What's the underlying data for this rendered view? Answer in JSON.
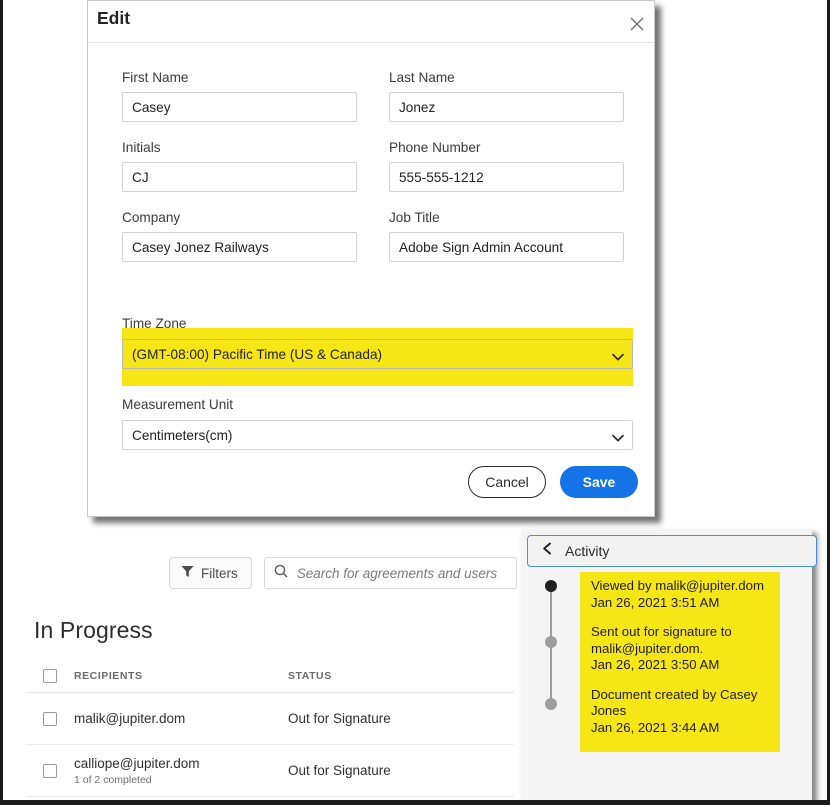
{
  "modal": {
    "title": "Edit",
    "close_icon": "close-icon",
    "fields": {
      "first_name": {
        "label": "First Name",
        "value": "Casey"
      },
      "last_name": {
        "label": "Last Name",
        "value": "Jonez"
      },
      "initials": {
        "label": "Initials",
        "value": "CJ"
      },
      "phone_number": {
        "label": "Phone Number",
        "value": "555-555-1212"
      },
      "company": {
        "label": "Company",
        "value": "Casey Jonez Railways"
      },
      "job_title": {
        "label": "Job Title",
        "value": "Adobe Sign Admin Account"
      },
      "time_zone": {
        "label": "Time Zone",
        "value": "(GMT-08:00) Pacific Time (US & Canada)"
      },
      "measurement_unit": {
        "label": "Measurement Unit",
        "value": "Centimeters(cm)"
      }
    },
    "cancel_label": "Cancel",
    "save_label": "Save"
  },
  "toolbar": {
    "filters_label": "Filters",
    "filter_icon": "funnel-icon",
    "search_icon": "search-icon",
    "search_placeholder": "Search for agreements and users...",
    "search_value": ""
  },
  "agreements": {
    "section_title": "In Progress",
    "columns": [
      "RECIPIENTS",
      "STATUS"
    ],
    "rows": [
      {
        "recipient": "malik@jupiter.dom",
        "sub": "",
        "status": "Out for Signature"
      },
      {
        "recipient": "calliope@jupiter.dom",
        "sub": "1 of 2 completed",
        "status": "Out for Signature"
      }
    ]
  },
  "activity": {
    "back_icon": "chevron-left-icon",
    "title": "Activity",
    "events": [
      {
        "text": "Viewed by malik@jupiter.dom",
        "timestamp": "Jan 26, 2021 3:51 AM"
      },
      {
        "text": "Sent out for signature to malik@jupiter.dom.",
        "timestamp": "Jan 26, 2021 3:50 AM"
      },
      {
        "text": "Document created by Casey Jones",
        "timestamp": "Jan 26, 2021 3:44 AM"
      }
    ]
  },
  "colors": {
    "highlight_yellow": "#f7e615",
    "primary_blue": "#1473e6",
    "focus_blue": "#4a90d9"
  }
}
